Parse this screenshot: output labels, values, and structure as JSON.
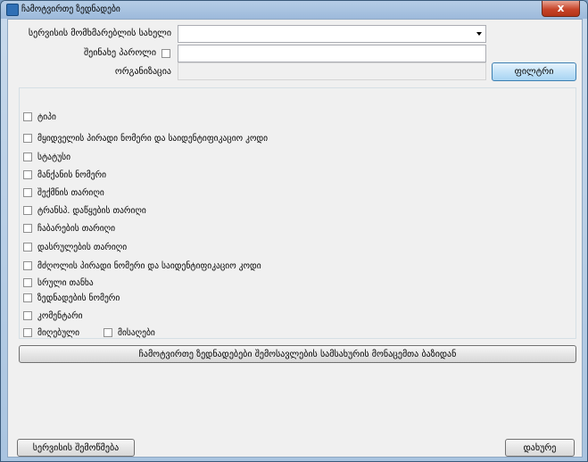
{
  "window": {
    "title": "ჩამოტვირთე ზედნადები",
    "close_glyph": "x"
  },
  "form": {
    "service_user_label": "სერვისის მომხმარებლის სახელი",
    "service_user_value": "",
    "password_label": "შეინახე პაროლი",
    "password_saved": false,
    "password_value": "",
    "organization_label": "ორგანიზაცია",
    "organization_value": "",
    "filter_button": "ფილტრი"
  },
  "columns": [
    {
      "label": "ტიპი",
      "checked": false
    },
    {
      "label": "მყიდველის პირადი ნომერი და საიდენტიფიკაციო კოდი",
      "checked": false
    },
    {
      "label": "სტატუსი",
      "checked": false
    },
    {
      "label": "მანქანის ნომერი",
      "checked": false
    },
    {
      "label": "შექმნის თარიღი",
      "checked": false
    },
    {
      "label": "ტრანსპ. დაწყების თარიღი",
      "checked": false
    },
    {
      "label": "ჩაბარების თარიღი",
      "checked": false
    },
    {
      "label": "დასრულების თარიღი",
      "checked": false
    },
    {
      "label": "მძღოლის პირადი ნომერი და საიდენტიფიკაციო კოდი",
      "checked": false
    },
    {
      "label": "სრული თანხა",
      "checked": false
    },
    {
      "label": "ზედნადების ნომერი",
      "checked": false
    },
    {
      "label": "კომენტარი",
      "checked": false
    },
    {
      "label": "მიღებული",
      "checked": false
    },
    {
      "label": "მისაღები",
      "checked": false
    }
  ],
  "actions": {
    "download_button": "ჩამოტვირთე ზედნადებები შემოსავლების სამსახურის მონაცემთა ბაზიდან",
    "check_service_button": "სერვისის შემოწმება",
    "close_button": "დახურე"
  }
}
